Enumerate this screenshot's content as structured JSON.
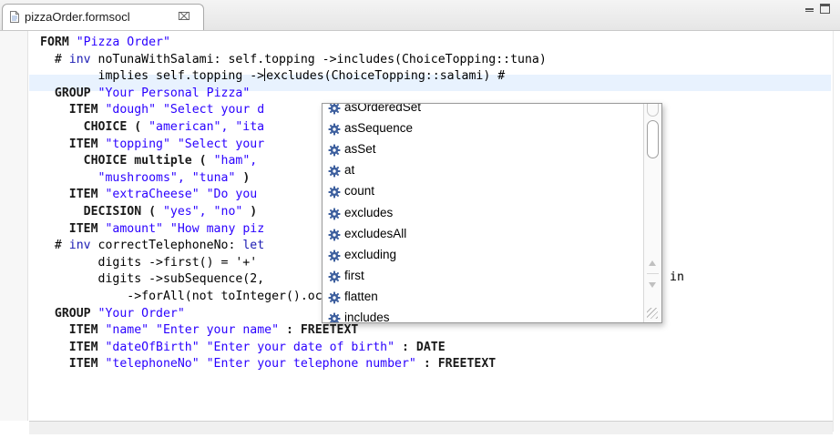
{
  "tab": {
    "filename": "pizzaOrder.formsocl",
    "close_glyph": "⌧",
    "file_icon": "file-icon",
    "close_icon": "close-icon"
  },
  "window_controls": {
    "minimize_icon": "minimize-icon",
    "maximize_icon": "maximize-icon"
  },
  "code": [
    {
      "tokens": [
        {
          "t": "FORM ",
          "c": "kw"
        },
        {
          "t": "\"Pizza Order\"",
          "c": "str"
        }
      ]
    },
    {
      "tokens": [
        {
          "t": "  # ",
          "c": ""
        },
        {
          "t": "inv",
          "c": "inv"
        },
        {
          "t": " noTunaWithSalami: self.topping ->includes(ChoiceTopping::tuna)",
          "c": ""
        }
      ]
    },
    {
      "tokens": [
        {
          "t": "        implies self.topping ->",
          "c": ""
        },
        {
          "t": "",
          "c": "caret"
        },
        {
          "t": "excludes(ChoiceTopping::salami) #",
          "c": ""
        }
      ]
    },
    {
      "tokens": [
        {
          "t": "  GROUP ",
          "c": "kw"
        },
        {
          "t": "\"Your Personal Pizza\"",
          "c": "str"
        }
      ]
    },
    {
      "tokens": [
        {
          "t": "    ITEM ",
          "c": "kw"
        },
        {
          "t": "\"dough\" \"Select your d",
          "c": "str"
        }
      ]
    },
    {
      "tokens": [
        {
          "t": "      CHOICE ( ",
          "c": "kw"
        },
        {
          "t": "\"american\", \"ita",
          "c": "str"
        }
      ]
    },
    {
      "tokens": [
        {
          "t": "    ITEM ",
          "c": "kw"
        },
        {
          "t": "\"topping\" \"Select your",
          "c": "str"
        }
      ]
    },
    {
      "tokens": [
        {
          "t": "      CHOICE multiple ( ",
          "c": "kw"
        },
        {
          "t": "\"ham\",",
          "c": "str"
        }
      ]
    },
    {
      "tokens": [
        {
          "t": "        ",
          "c": ""
        },
        {
          "t": "\"mushrooms\", \"tuna\"",
          "c": "str"
        },
        {
          "t": " )",
          "c": "kw"
        }
      ]
    },
    {
      "tokens": [
        {
          "t": "    ITEM ",
          "c": "kw"
        },
        {
          "t": "\"extraCheese\" \"Do you",
          "c": "str"
        }
      ]
    },
    {
      "tokens": [
        {
          "t": "      DECISION ( ",
          "c": "kw"
        },
        {
          "t": "\"yes\", \"no\"",
          "c": "str"
        },
        {
          "t": " )",
          "c": "kw"
        }
      ]
    },
    {
      "tokens": [
        {
          "t": "    ITEM ",
          "c": "kw"
        },
        {
          "t": "\"amount\" \"How many piz",
          "c": "str"
        }
      ]
    },
    {
      "tokens": [
        {
          "t": "  # ",
          "c": ""
        },
        {
          "t": "inv",
          "c": "inv"
        },
        {
          "t": " correctTelephoneNo: ",
          "c": ""
        },
        {
          "t": "let",
          "c": "inv"
        }
      ]
    },
    {
      "tokens": [
        {
          "t": "        digits ->first() = '+'",
          "c": ""
        }
      ]
    },
    {
      "tokens": [
        {
          "t": "        digits ->subSequence(2,",
          "c": ""
        }
      ]
    },
    {
      "tokens": [
        {
          "t": "            ->forAll(not toInteger().oclIsInvalid()) #",
          "c": ""
        }
      ]
    },
    {
      "tokens": [
        {
          "t": "  GROUP ",
          "c": "kw"
        },
        {
          "t": "\"Your Order\"",
          "c": "str"
        }
      ]
    },
    {
      "tokens": [
        {
          "t": "    ITEM ",
          "c": "kw"
        },
        {
          "t": "\"name\" \"Enter your name\"",
          "c": "str"
        },
        {
          "t": " : FREETEXT",
          "c": "kw"
        }
      ]
    },
    {
      "tokens": [
        {
          "t": "    ITEM ",
          "c": "kw"
        },
        {
          "t": "\"dateOfBirth\" \"Enter your date of birth\"",
          "c": "str"
        },
        {
          "t": " : DATE",
          "c": "kw"
        }
      ]
    },
    {
      "tokens": [
        {
          "t": "    ITEM ",
          "c": "kw"
        },
        {
          "t": "\"telephoneNo\" \"Enter your telephone number\"",
          "c": "str"
        },
        {
          "t": " : FREETEXT",
          "c": "kw"
        }
      ]
    }
  ],
  "overflow_text": {
    "in_keyword": "in"
  },
  "completion": {
    "items": [
      "asOrderedSet",
      "asSequence",
      "asSet",
      "at",
      "count",
      "excludes",
      "excludesAll",
      "excluding",
      "first",
      "flatten",
      "includes"
    ],
    "item_icon": "gear-icon"
  },
  "colors": {
    "keyword": "#1a1a1a",
    "string": "#2a00ff",
    "inv": "#1b1bb3",
    "current_line": "#e8f2fe"
  }
}
